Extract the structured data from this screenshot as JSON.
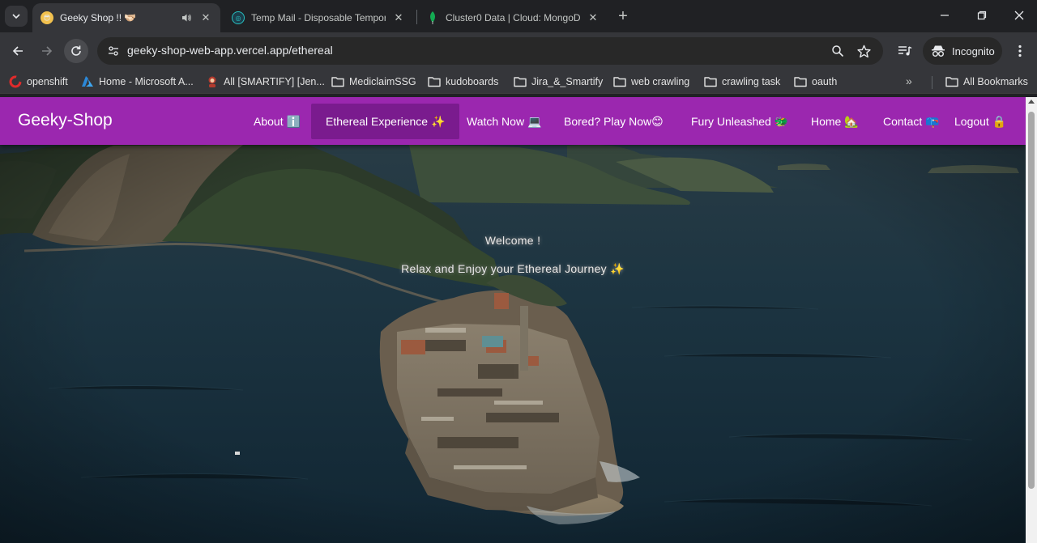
{
  "tabs": [
    {
      "title": "Geeky Shop !! 🫱🏻‍🫲🏼",
      "active": true,
      "audio": true
    },
    {
      "title": "Temp Mail - Disposable Tempor",
      "active": false
    },
    {
      "title": "Cluster0 Data | Cloud: MongoD",
      "active": false
    }
  ],
  "address_bar": {
    "url": "geeky-shop-web-app.vercel.app/ethereal"
  },
  "profile": {
    "label": "Incognito"
  },
  "bookmarks": [
    {
      "label": "openshift",
      "icon": "openshift-icon"
    },
    {
      "label": "Home - Microsoft A...",
      "icon": "azure-icon"
    },
    {
      "label": "All [SMARTIFY] [Jen...",
      "icon": "jenkins-icon"
    },
    {
      "label": "MediclaimSSG",
      "icon": "folder-icon"
    },
    {
      "label": "kudoboards",
      "icon": "folder-icon"
    },
    {
      "label": "Jira_&_Smartify",
      "icon": "folder-icon"
    },
    {
      "label": "web crawling",
      "icon": "folder-icon"
    },
    {
      "label": "crawling task",
      "icon": "folder-icon"
    },
    {
      "label": "oauth",
      "icon": "folder-icon"
    }
  ],
  "all_bookmarks_label": "All Bookmarks",
  "site": {
    "brand": "Geeky-Shop",
    "nav": [
      {
        "label": "About ℹ️"
      },
      {
        "label": "Ethereal Experience ✨",
        "active": true
      },
      {
        "label": "Watch Now 💻"
      },
      {
        "label": "Bored? Play Now😊"
      },
      {
        "label": "Fury Unleashed 🐲"
      },
      {
        "label": "Home 🏡"
      },
      {
        "label": "Contact 📪"
      },
      {
        "label": "Logout 🔒"
      }
    ],
    "hero": {
      "welcome": "Welcome !",
      "subtitle": "Relax and Enjoy your Ethereal Journey ✨"
    }
  },
  "colors": {
    "nav_bg": "#9b27af",
    "nav_active": "#7a1b8e",
    "browser_bg": "#202124",
    "toolbar_bg": "#35363a"
  }
}
